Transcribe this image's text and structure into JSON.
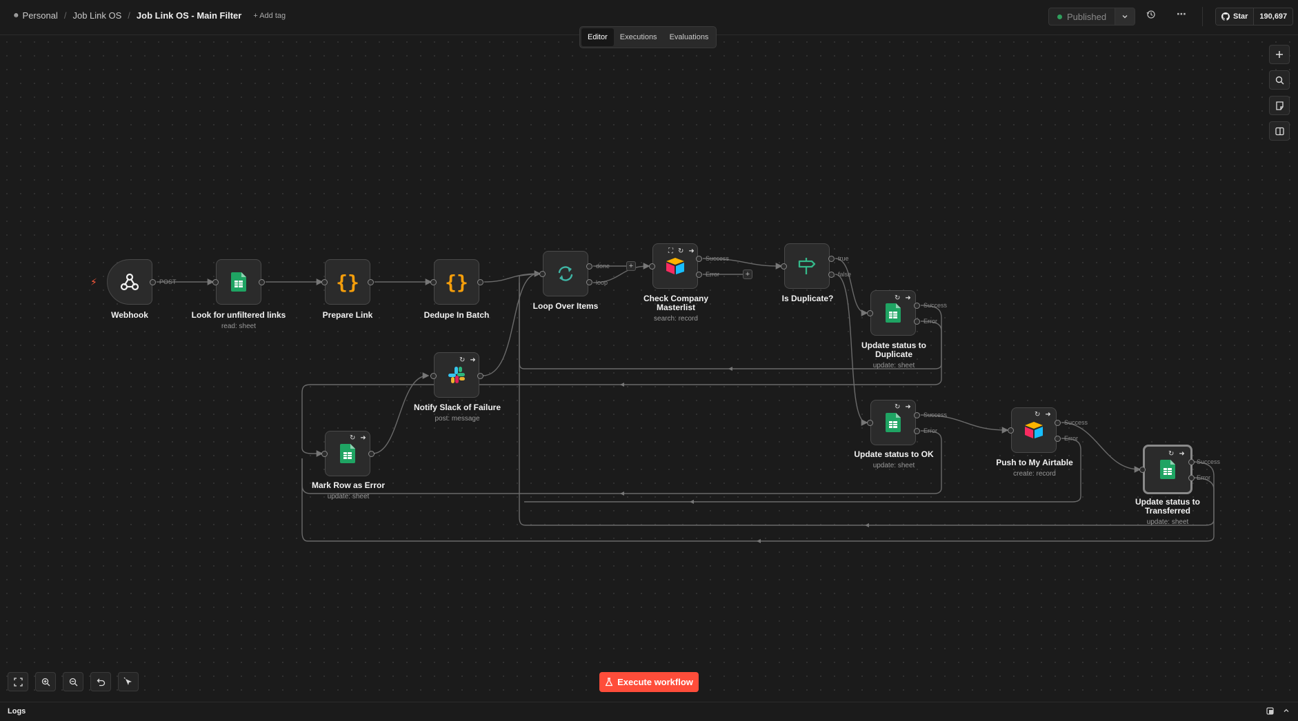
{
  "breadcrumb": {
    "project": "Personal",
    "folder": "Job Link OS",
    "workflow": "Job Link OS - Main Filter",
    "add_tag": "+ Add tag"
  },
  "header": {
    "status": "Published",
    "github_star": "Star",
    "github_count": "190,697"
  },
  "tabs": [
    "Editor",
    "Executions",
    "Evaluations"
  ],
  "active_tab": "Editor",
  "nodes": {
    "webhook": {
      "label": "Webhook",
      "sub": "",
      "icon": "webhook-icon"
    },
    "look_for_unfiltered": {
      "label": "Look for unfiltered links",
      "sub": "read: sheet",
      "icon": "google-sheets-icon"
    },
    "prepare_link": {
      "label": "Prepare Link",
      "sub": "",
      "icon": "code-braces-icon"
    },
    "dedupe_in_batch": {
      "label": "Dedupe In Batch",
      "sub": "",
      "icon": "code-braces-icon"
    },
    "loop_over_items": {
      "label": "Loop Over Items",
      "sub": "",
      "icon": "loop-icon"
    },
    "check_company": {
      "label": "Check Company Masterlist",
      "sub": "search: record",
      "icon": "airtable-icon"
    },
    "is_duplicate": {
      "label": "Is Duplicate?",
      "sub": "",
      "icon": "if-signpost-icon"
    },
    "update_duplicate": {
      "label": "Update status to Duplicate",
      "sub": "update: sheet",
      "icon": "google-sheets-icon"
    },
    "notify_slack": {
      "label": "Notify Slack of Failure",
      "sub": "post: message",
      "icon": "slack-icon"
    },
    "mark_row_error": {
      "label": "Mark Row as Error",
      "sub": "update: sheet",
      "icon": "google-sheets-icon"
    },
    "update_ok": {
      "label": "Update status to OK",
      "sub": "update: sheet",
      "icon": "google-sheets-icon"
    },
    "push_airtable": {
      "label": "Push to My Airtable",
      "sub": "create: record",
      "icon": "airtable-icon"
    },
    "update_transferred": {
      "label": "Update status to Transferred",
      "sub": "update: sheet",
      "icon": "google-sheets-icon"
    }
  },
  "port_labels": {
    "post": "POST",
    "done": "done",
    "loop": "loop",
    "success": "Success",
    "error": "Error",
    "true": "true",
    "false": "false"
  },
  "execute_button": "Execute workflow",
  "logs_title": "Logs",
  "colors": {
    "background": "#1b1b1b",
    "accent": "#ff4d3a",
    "sheets_green": "#1fa463",
    "code_orange": "#f59e0b",
    "loop_teal": "#3fb6a6",
    "if_green": "#35b98a"
  }
}
